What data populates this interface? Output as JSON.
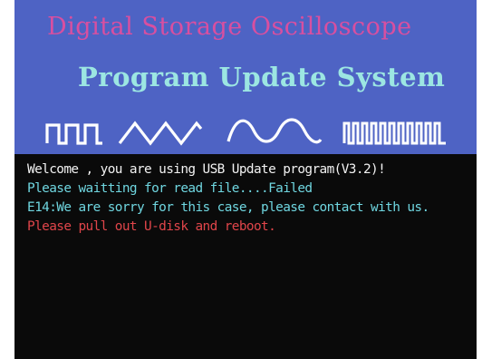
{
  "header": {
    "title_small": "Digital Storage Oscilloscope",
    "title_large": "Program Update System",
    "title_small_color": "#d84fa0",
    "title_large_color": "#9ce6e2",
    "background_color": "#4e63c4",
    "wave_icons": [
      "square-wave-icon",
      "triangle-wave-icon",
      "sine-wave-icon",
      "pulse-train-icon"
    ]
  },
  "console": {
    "background_color": "#0a0a0a",
    "lines": [
      {
        "text": "Welcome , you are using USB Update program(V3.2)!",
        "color": "#f2f2f2"
      },
      {
        "text": "Please waitting for read file....Failed",
        "color": "#6fd6e0"
      },
      {
        "text": "E14:We are sorry for this case, please contact with us.",
        "color": "#6fd6e0"
      },
      {
        "text": "Please pull out U-disk and reboot.",
        "color": "#e0454a"
      }
    ]
  }
}
